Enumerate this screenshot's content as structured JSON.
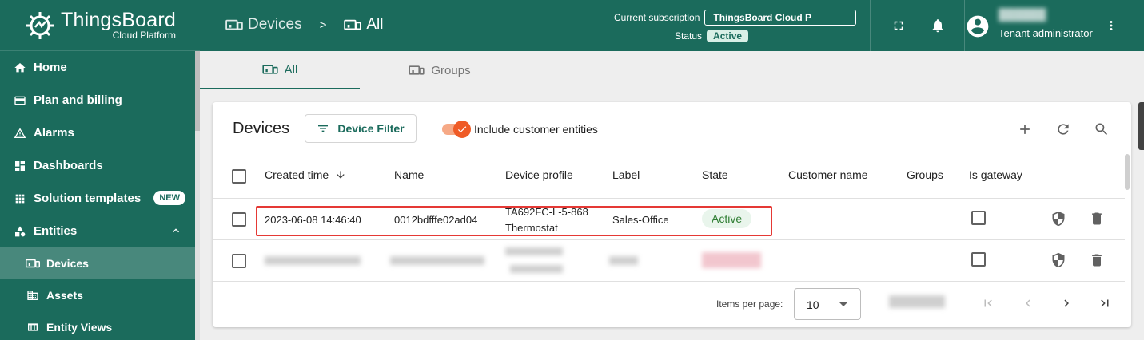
{
  "app": {
    "title": "ThingsBoard",
    "subtitle": "Cloud Platform"
  },
  "sidebar": {
    "items": [
      {
        "label": "Home",
        "icon": "home-icon"
      },
      {
        "label": "Plan and billing",
        "icon": "credit-card-icon"
      },
      {
        "label": "Alarms",
        "icon": "warning-icon"
      },
      {
        "label": "Dashboards",
        "icon": "dashboard-icon"
      },
      {
        "label": "Solution templates",
        "icon": "apps-icon",
        "badge": "NEW"
      },
      {
        "label": "Entities",
        "icon": "category-icon",
        "expanded": true
      }
    ],
    "subitems": [
      {
        "label": "Devices",
        "icon": "devices-icon",
        "active": true
      },
      {
        "label": "Assets",
        "icon": "domain-icon"
      },
      {
        "label": "Entity Views",
        "icon": "view-icon"
      }
    ]
  },
  "header": {
    "breadcrumb": [
      {
        "label": "Devices",
        "icon": "devices-icon"
      },
      {
        "label": "All",
        "icon": "devices-icon"
      }
    ],
    "breadcrumb_separator": ">",
    "subscription_label": "Current subscription",
    "subscription_value": "ThingsBoard Cloud P",
    "status_label": "Status",
    "status_value": "Active",
    "user_role": "Tenant administrator"
  },
  "tabs": [
    {
      "label": "All",
      "active": true
    },
    {
      "label": "Groups",
      "active": false
    }
  ],
  "card": {
    "title": "Devices",
    "filter_button": "Device Filter",
    "toggle_label": "Include customer entities",
    "toggle_on": true
  },
  "table": {
    "columns": [
      "Created time",
      "Name",
      "Device profile",
      "Label",
      "State",
      "Customer name",
      "Groups",
      "Is gateway"
    ],
    "rows": [
      {
        "created_time": "2023-06-08 14:46:40",
        "name": "0012bdfffe02ad04",
        "device_profile_line1": "TA692FC-L-5-868",
        "device_profile_line2": "Thermostat",
        "label": "Sales-Office",
        "state": "Active",
        "customer_name": "",
        "groups": "",
        "is_gateway": false
      }
    ]
  },
  "pagination": {
    "items_per_page_label": "Items per page:",
    "items_per_page": "10"
  },
  "colors": {
    "primary": "#1b6b5c",
    "accent": "#ef5b26",
    "highlight": "#e53935",
    "active_state": "#2e7d32"
  }
}
